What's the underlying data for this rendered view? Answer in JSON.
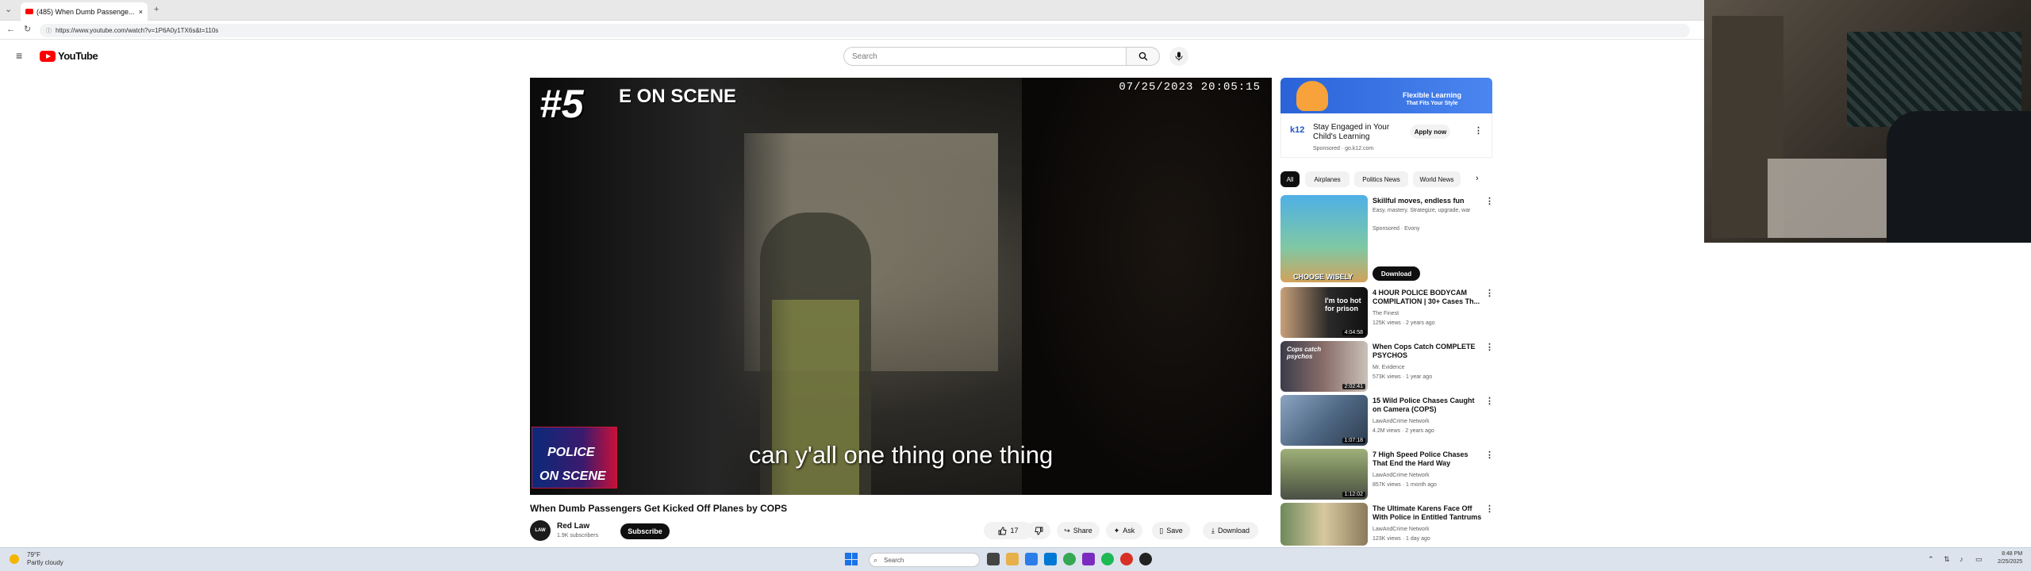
{
  "browser": {
    "tab_title": "(485) When Dumb Passenge...",
    "tab_close": "×",
    "new_tab": "+",
    "url": "https://www.youtube.com/watch?v=1P6A0y1TX6s&t=110s"
  },
  "youtube": {
    "logo_text": "YouTube",
    "search_placeholder": "Search"
  },
  "player": {
    "rank": "#5",
    "overlay_title": "E ON SCENE",
    "timestamp": "07/25/2023 20:05:15",
    "badge_line1": "POLICE",
    "badge_line2": "ON SCENE",
    "caption": "can y'all one thing one thing"
  },
  "video": {
    "title": "When Dumb Passengers Get Kicked Off Planes by COPS",
    "channel": "Red Law",
    "channel_avatar": "LAW",
    "subscribers": "1.9K subscribers",
    "subscribe": "Subscribe",
    "likes": "17",
    "share": "Share",
    "ask": "Ask",
    "save": "Save",
    "download": "Download"
  },
  "ad": {
    "banner_line1": "Flexible Learning",
    "banner_line2": "That Fits Your Style",
    "logo": "k12",
    "title": "Stay Engaged in Your Child's Learning",
    "sponsored": "Sponsored · go.k12.com",
    "apply": "Apply now"
  },
  "chips": [
    "All",
    "Airplanes",
    "Politics News",
    "World News"
  ],
  "recommendations": [
    {
      "title": "Skillful moves, endless fun",
      "channel": "Easy, mastery. Strategize, upgrade, war",
      "meta": "Sponsored · Evony",
      "thumb_text": "CHOOSE WISELY",
      "duration": "",
      "action": "Download"
    },
    {
      "title": "4 HOUR POLICE BODYCAM COMPILATION | 30+ Cases Th...",
      "channel": "The Finest",
      "meta": "125K views · 2 years ago",
      "thumb_text": "I'm too hot for prison",
      "duration": "4:04:58"
    },
    {
      "title": "When Cops Catch COMPLETE PSYCHOS",
      "channel": "Mr. Evidence",
      "meta": "573K views · 1 year ago",
      "thumb_text": "Cops catch psychos",
      "duration": "2:02:41"
    },
    {
      "title": "15 Wild Police Chases Caught on Camera (COPS)",
      "channel": "LawAndCrime Network",
      "meta": "4.2M views · 2 years ago",
      "thumb_text": "",
      "duration": "1:07:18"
    },
    {
      "title": "7 High Speed Police Chases That End the Hard Way",
      "channel": "LawAndCrime Network",
      "meta": "857K views · 1 month ago",
      "thumb_text": "",
      "duration": "1:12:02"
    },
    {
      "title": "The Ultimate Karens Face Off With Police in Entitled Tantrums",
      "channel": "LawAndCrime Network",
      "meta": "123K views · 1 day ago",
      "thumb_text": "",
      "duration": ""
    }
  ],
  "taskbar": {
    "weather_temp": "79°F",
    "weather_desc": "Partly cloudy",
    "search": "Search",
    "time": "8:48 PM",
    "date": "2/25/2025"
  },
  "colors": {
    "brand_red": "#ff0000",
    "chip_active": "#0f0f0f",
    "ad_blue": "#2a63d8"
  }
}
